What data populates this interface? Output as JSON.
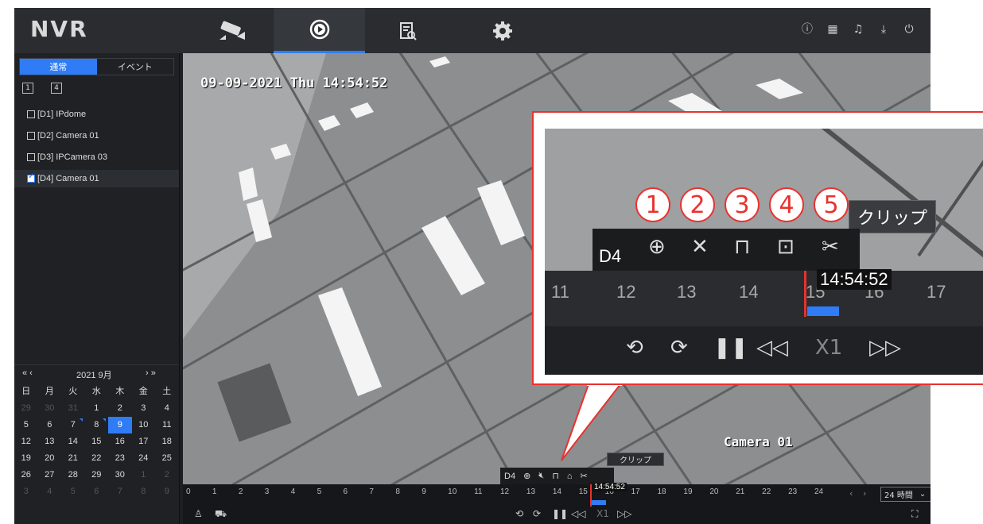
{
  "app": {
    "logo": "NVR"
  },
  "nav": {
    "tabs": [
      {
        "name": "live-view",
        "icon": "camera-icon"
      },
      {
        "name": "playback",
        "icon": "playback-icon"
      },
      {
        "name": "search",
        "icon": "file-search-icon"
      },
      {
        "name": "settings",
        "icon": "gear-icon"
      }
    ],
    "active": "playback"
  },
  "sidebar": {
    "mode_tabs": [
      "通常",
      "イベント"
    ],
    "layout_buttons": [
      "1",
      "4"
    ],
    "cameras": [
      {
        "label": "[D1] IPdome",
        "checked": false
      },
      {
        "label": "[D2] Camera 01",
        "checked": false
      },
      {
        "label": "[D3] IPCamera 03",
        "checked": false
      },
      {
        "label": "[D4] Camera 01",
        "checked": true
      }
    ]
  },
  "calendar": {
    "nav_prev": "« ‹",
    "nav_next": "› »",
    "month_label": "2021 9月",
    "weekdays": [
      "日",
      "月",
      "火",
      "水",
      "木",
      "金",
      "土"
    ],
    "weeks": [
      [
        "29",
        "30",
        "31",
        "1",
        "2",
        "3",
        "4"
      ],
      [
        "5",
        "6",
        "7",
        "8",
        "9",
        "10",
        "11"
      ],
      [
        "12",
        "13",
        "14",
        "15",
        "16",
        "17",
        "18"
      ],
      [
        "19",
        "20",
        "21",
        "22",
        "23",
        "24",
        "25"
      ],
      [
        "26",
        "27",
        "28",
        "29",
        "30",
        "1",
        "2"
      ],
      [
        "3",
        "4",
        "5",
        "6",
        "7",
        "8",
        "9"
      ]
    ],
    "selected_day": "9"
  },
  "video": {
    "osd_time": "09-09-2021 Thu 14:54:52",
    "camera_label": "Camera 01"
  },
  "timeline": {
    "ticks": [
      "0",
      "1",
      "2",
      "3",
      "4",
      "5",
      "6",
      "7",
      "8",
      "9",
      "10",
      "11",
      "12",
      "13",
      "14",
      "15",
      "16",
      "17",
      "18",
      "19",
      "20",
      "21",
      "22",
      "23",
      "24"
    ],
    "zoom": "24 時間",
    "current_time": "14:54:52"
  },
  "toolbar": {
    "channel": "D4",
    "clip_tooltip": "クリップ"
  },
  "controls": {
    "speed": "X1"
  },
  "callout": {
    "numbers": [
      "1",
      "2",
      "3",
      "4",
      "5"
    ],
    "channel": "D4",
    "clip_label": "クリップ",
    "ticks": [
      "11",
      "12",
      "13",
      "14",
      "15",
      "16",
      "17"
    ],
    "time": "14:54:52",
    "speed": "X1"
  },
  "colors": {
    "accent": "#2f7cf6",
    "highlight": "#e8322f"
  }
}
